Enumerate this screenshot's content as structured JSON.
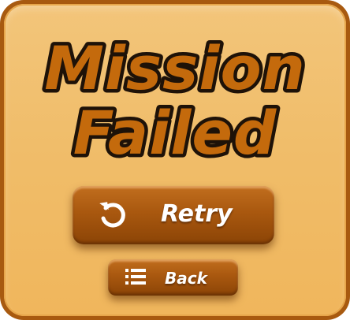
{
  "dialog": {
    "title_line1": "Mission",
    "title_line2": "Failed",
    "colors": {
      "frame": "#a85a10",
      "panel": "#f0bd6a",
      "title_fill": "#c46a0c",
      "title_outline": "#1e1208",
      "button": "#a9580f"
    }
  },
  "buttons": {
    "retry": {
      "label": "Retry",
      "icon": "retry-icon"
    },
    "back": {
      "label": "Back",
      "icon": "list-icon"
    }
  }
}
